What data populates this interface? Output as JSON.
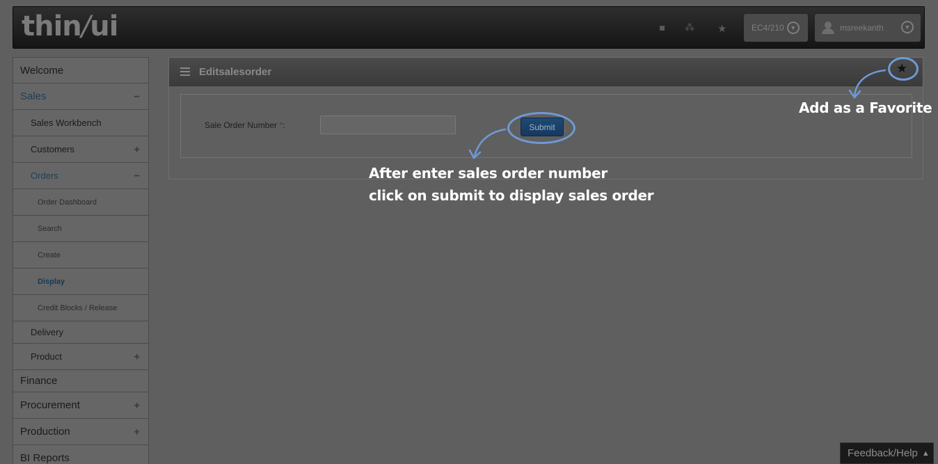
{
  "header": {
    "logo_text": "thinui",
    "icons": [
      "document-icon",
      "org-icon",
      "star-icon"
    ],
    "system": "EC4/210",
    "user": "msreekanth"
  },
  "sidebar": {
    "items": [
      {
        "label": "Welcome",
        "level": 1,
        "toggle": ""
      },
      {
        "label": "Sales",
        "level": 1,
        "toggle": "−",
        "state": "active"
      },
      {
        "label": "Sales Workbench",
        "level": 2,
        "toggle": ""
      },
      {
        "label": "Customers",
        "level": 2,
        "toggle": "+"
      },
      {
        "label": "Orders",
        "level": 2,
        "toggle": "−",
        "state": "active"
      },
      {
        "label": "Order Dashboard",
        "level": 3,
        "toggle": ""
      },
      {
        "label": "Search",
        "level": 3,
        "toggle": ""
      },
      {
        "label": "Create",
        "level": 3,
        "toggle": ""
      },
      {
        "label": "Display",
        "level": 3,
        "toggle": "",
        "state": "selected"
      },
      {
        "label": "Credit Blocks / Release",
        "level": 3,
        "toggle": ""
      },
      {
        "label": "Delivery",
        "level": 2,
        "toggle": ""
      },
      {
        "label": "Product",
        "level": 2,
        "toggle": "+"
      },
      {
        "label": "Finance",
        "level": 1,
        "toggle": ""
      },
      {
        "label": "Procurement",
        "level": 1,
        "toggle": "+"
      },
      {
        "label": "Production",
        "level": 1,
        "toggle": "+"
      },
      {
        "label": "BI Reports",
        "level": 1,
        "toggle": ""
      }
    ]
  },
  "panel": {
    "title": "Editsalesorder",
    "field_label": "Sale Order Number",
    "required_mark": "*",
    "field_colon": ":",
    "field_value": "",
    "submit_label": "Submit"
  },
  "annotations": {
    "favorite": "Add as a Favorite",
    "submit_line1": "After enter sales order number",
    "submit_line2": "click on submit to display sales order",
    "ring_color": "#6e9ad8"
  },
  "feedback": {
    "label": "Feedback/Help"
  }
}
